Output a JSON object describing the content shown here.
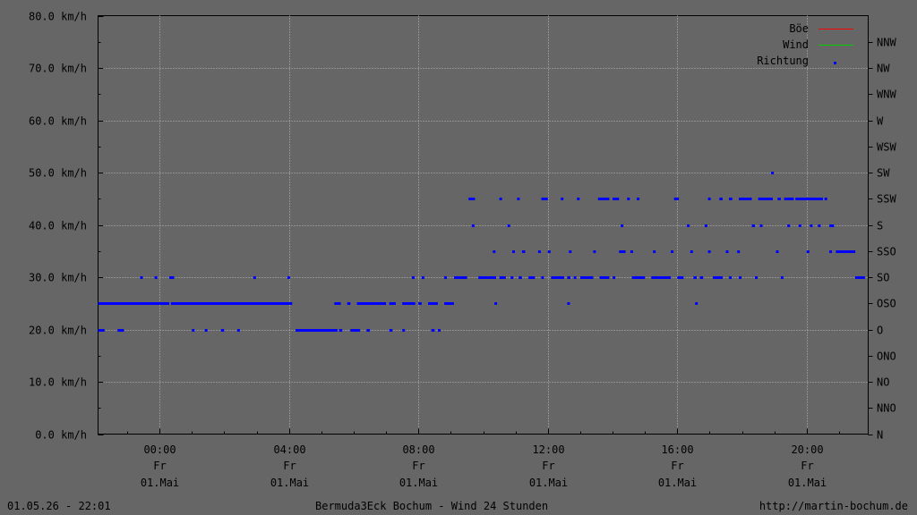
{
  "footer": {
    "timestamp": "01.05.26 - 22:01",
    "title": "Bermuda3Eck Bochum - Wind 24 Stunden",
    "url": "http://martin-bochum.de"
  },
  "chart_data": {
    "type": "scatter",
    "title": "Bermuda3Eck Bochum - Wind 24 Stunden",
    "xlabel": "",
    "ylabel": "",
    "x_unit": "hours since 00:00, 01.Mai",
    "xlim": [
      -1.9,
      21.9
    ],
    "ylim": [
      0,
      80
    ],
    "grid": true,
    "legend_position": "top-right",
    "y_ticks": [
      "0.0 km/h",
      "10.0 km/h",
      "20.0 km/h",
      "30.0 km/h",
      "40.0 km/h",
      "50.0 km/h",
      "60.0 km/h",
      "70.0 km/h",
      "80.0 km/h"
    ],
    "y2_ticks": [
      "N",
      "NNO",
      "NO",
      "ONO",
      "O",
      "OSO",
      "SO",
      "SSO",
      "S",
      "SSW",
      "SW",
      "WSW",
      "W",
      "WNW",
      "NW",
      "NNW"
    ],
    "x_ticks": [
      {
        "x": 0,
        "time": "00:00",
        "day": "Fr",
        "date": "01.Mai"
      },
      {
        "x": 4,
        "time": "04:00",
        "day": "Fr",
        "date": "01.Mai"
      },
      {
        "x": 8,
        "time": "08:00",
        "day": "Fr",
        "date": "01.Mai"
      },
      {
        "x": 12,
        "time": "12:00",
        "day": "Fr",
        "date": "01.Mai"
      },
      {
        "x": 16,
        "time": "16:00",
        "day": "Fr",
        "date": "01.Mai"
      },
      {
        "x": 20,
        "time": "20:00",
        "day": "Fr",
        "date": "01.Mai"
      }
    ],
    "series": [
      {
        "name": "Böe",
        "color": "#ff0000",
        "style": "line",
        "values": []
      },
      {
        "name": "Wind",
        "color": "#00cc00",
        "style": "line",
        "values": []
      },
      {
        "name": "Richtung",
        "color": "#0000ff",
        "style": "points",
        "segments": [
          {
            "x0": -1.9,
            "x1": 0.3,
            "y": 25
          },
          {
            "x0": 0.35,
            "x1": 4.1,
            "y": 25
          },
          {
            "x0": -1.9,
            "x1": -1.7,
            "y": 20
          },
          {
            "x0": -1.3,
            "x1": -1.1,
            "y": 20
          },
          {
            "x0": 1.0,
            "x1": 1.05,
            "y": 20
          },
          {
            "x0": 1.4,
            "x1": 1.45,
            "y": 20
          },
          {
            "x0": 1.9,
            "x1": 2.0,
            "y": 20
          },
          {
            "x0": 2.4,
            "x1": 2.45,
            "y": 20
          },
          {
            "x0": -0.6,
            "x1": -0.55,
            "y": 30
          },
          {
            "x0": -0.15,
            "x1": -0.1,
            "y": 30
          },
          {
            "x0": 0.3,
            "x1": 0.45,
            "y": 30
          },
          {
            "x0": 2.9,
            "x1": 2.95,
            "y": 30
          },
          {
            "x0": 3.95,
            "x1": 4.0,
            "y": 30
          },
          {
            "x0": 4.2,
            "x1": 5.5,
            "y": 20
          },
          {
            "x0": 5.55,
            "x1": 5.65,
            "y": 20
          },
          {
            "x0": 5.9,
            "x1": 6.2,
            "y": 20
          },
          {
            "x0": 6.4,
            "x1": 6.5,
            "y": 20
          },
          {
            "x0": 7.1,
            "x1": 7.2,
            "y": 20
          },
          {
            "x0": 7.5,
            "x1": 7.55,
            "y": 20
          },
          {
            "x0": 8.4,
            "x1": 8.5,
            "y": 20
          },
          {
            "x0": 8.6,
            "x1": 8.65,
            "y": 20
          },
          {
            "x0": 5.4,
            "x1": 5.6,
            "y": 25
          },
          {
            "x0": 5.8,
            "x1": 5.9,
            "y": 25
          },
          {
            "x0": 6.1,
            "x1": 7.0,
            "y": 25
          },
          {
            "x0": 7.1,
            "x1": 7.3,
            "y": 25
          },
          {
            "x0": 7.5,
            "x1": 7.9,
            "y": 25
          },
          {
            "x0": 8.0,
            "x1": 8.1,
            "y": 25
          },
          {
            "x0": 8.3,
            "x1": 8.6,
            "y": 25
          },
          {
            "x0": 8.8,
            "x1": 9.1,
            "y": 25
          },
          {
            "x0": 7.8,
            "x1": 7.85,
            "y": 30
          },
          {
            "x0": 8.1,
            "x1": 8.15,
            "y": 30
          },
          {
            "x0": 8.8,
            "x1": 8.85,
            "y": 30
          },
          {
            "x0": 9.1,
            "x1": 9.5,
            "y": 30
          },
          {
            "x0": 9.85,
            "x1": 10.4,
            "y": 30
          },
          {
            "x0": 10.5,
            "x1": 10.7,
            "y": 30
          },
          {
            "x0": 10.85,
            "x1": 10.9,
            "y": 30
          },
          {
            "x0": 11.1,
            "x1": 11.2,
            "y": 30
          },
          {
            "x0": 11.4,
            "x1": 11.6,
            "y": 30
          },
          {
            "x0": 11.8,
            "x1": 11.85,
            "y": 30
          },
          {
            "x0": 12.1,
            "x1": 12.5,
            "y": 30
          },
          {
            "x0": 12.6,
            "x1": 12.7,
            "y": 30
          },
          {
            "x0": 12.8,
            "x1": 12.85,
            "y": 30
          },
          {
            "x0": 13.0,
            "x1": 13.4,
            "y": 30
          },
          {
            "x0": 13.6,
            "x1": 13.9,
            "y": 30
          },
          {
            "x0": 14.0,
            "x1": 14.05,
            "y": 30
          },
          {
            "x0": 14.6,
            "x1": 15.0,
            "y": 30
          },
          {
            "x0": 15.2,
            "x1": 15.8,
            "y": 30
          },
          {
            "x0": 16.0,
            "x1": 16.2,
            "y": 30
          },
          {
            "x0": 16.5,
            "x1": 16.6,
            "y": 30
          },
          {
            "x0": 16.7,
            "x1": 16.8,
            "y": 30
          },
          {
            "x0": 17.1,
            "x1": 17.4,
            "y": 30
          },
          {
            "x0": 17.6,
            "x1": 17.65,
            "y": 30
          },
          {
            "x0": 17.9,
            "x1": 17.95,
            "y": 30
          },
          {
            "x0": 18.4,
            "x1": 18.45,
            "y": 30
          },
          {
            "x0": 19.2,
            "x1": 19.25,
            "y": 30
          },
          {
            "x0": 21.5,
            "x1": 21.8,
            "y": 30
          },
          {
            "x0": 10.35,
            "x1": 10.4,
            "y": 25
          },
          {
            "x0": 12.6,
            "x1": 12.65,
            "y": 25
          },
          {
            "x0": 16.55,
            "x1": 16.6,
            "y": 25
          },
          {
            "x0": 10.3,
            "x1": 10.35,
            "y": 35
          },
          {
            "x0": 10.9,
            "x1": 10.95,
            "y": 35
          },
          {
            "x0": 11.2,
            "x1": 11.3,
            "y": 35
          },
          {
            "x0": 11.7,
            "x1": 11.75,
            "y": 35
          },
          {
            "x0": 12.0,
            "x1": 12.05,
            "y": 35
          },
          {
            "x0": 12.65,
            "x1": 12.7,
            "y": 35
          },
          {
            "x0": 13.4,
            "x1": 13.45,
            "y": 35
          },
          {
            "x0": 14.2,
            "x1": 14.4,
            "y": 35
          },
          {
            "x0": 14.55,
            "x1": 14.6,
            "y": 35
          },
          {
            "x0": 15.25,
            "x1": 15.3,
            "y": 35
          },
          {
            "x0": 15.8,
            "x1": 15.85,
            "y": 35
          },
          {
            "x0": 16.4,
            "x1": 16.45,
            "y": 35
          },
          {
            "x0": 16.95,
            "x1": 17.0,
            "y": 35
          },
          {
            "x0": 17.5,
            "x1": 17.55,
            "y": 35
          },
          {
            "x0": 17.85,
            "x1": 17.9,
            "y": 35
          },
          {
            "x0": 19.05,
            "x1": 19.1,
            "y": 35
          },
          {
            "x0": 20.0,
            "x1": 20.05,
            "y": 35
          },
          {
            "x0": 20.7,
            "x1": 20.75,
            "y": 35
          },
          {
            "x0": 20.9,
            "x1": 21.5,
            "y": 35
          },
          {
            "x0": 9.65,
            "x1": 9.7,
            "y": 40
          },
          {
            "x0": 10.75,
            "x1": 10.8,
            "y": 40
          },
          {
            "x0": 14.25,
            "x1": 14.3,
            "y": 40
          },
          {
            "x0": 16.3,
            "x1": 16.35,
            "y": 40
          },
          {
            "x0": 16.85,
            "x1": 16.9,
            "y": 40
          },
          {
            "x0": 18.3,
            "x1": 18.4,
            "y": 40
          },
          {
            "x0": 18.55,
            "x1": 18.6,
            "y": 40
          },
          {
            "x0": 19.4,
            "x1": 19.45,
            "y": 40
          },
          {
            "x0": 19.75,
            "x1": 19.8,
            "y": 40
          },
          {
            "x0": 20.1,
            "x1": 20.15,
            "y": 40
          },
          {
            "x0": 20.35,
            "x1": 20.4,
            "y": 40
          },
          {
            "x0": 20.7,
            "x1": 20.85,
            "y": 40
          },
          {
            "x0": 9.55,
            "x1": 9.75,
            "y": 45
          },
          {
            "x0": 10.5,
            "x1": 10.55,
            "y": 45
          },
          {
            "x0": 11.05,
            "x1": 11.1,
            "y": 45
          },
          {
            "x0": 11.8,
            "x1": 12.0,
            "y": 45
          },
          {
            "x0": 12.4,
            "x1": 12.45,
            "y": 45
          },
          {
            "x0": 12.9,
            "x1": 12.95,
            "y": 45
          },
          {
            "x0": 13.55,
            "x1": 13.9,
            "y": 45
          },
          {
            "x0": 14.0,
            "x1": 14.2,
            "y": 45
          },
          {
            "x0": 14.45,
            "x1": 14.5,
            "y": 45
          },
          {
            "x0": 14.75,
            "x1": 14.8,
            "y": 45
          },
          {
            "x0": 15.9,
            "x1": 16.05,
            "y": 45
          },
          {
            "x0": 16.95,
            "x1": 17.0,
            "y": 45
          },
          {
            "x0": 17.3,
            "x1": 17.4,
            "y": 45
          },
          {
            "x0": 17.6,
            "x1": 17.7,
            "y": 45
          },
          {
            "x0": 17.9,
            "x1": 18.3,
            "y": 45
          },
          {
            "x0": 18.5,
            "x1": 18.95,
            "y": 45
          },
          {
            "x0": 19.1,
            "x1": 19.2,
            "y": 45
          },
          {
            "x0": 19.3,
            "x1": 19.6,
            "y": 45
          },
          {
            "x0": 19.65,
            "x1": 20.5,
            "y": 45
          },
          {
            "x0": 20.55,
            "x1": 20.6,
            "y": 45
          },
          {
            "x0": 18.9,
            "x1": 18.95,
            "y": 50
          }
        ]
      }
    ]
  }
}
